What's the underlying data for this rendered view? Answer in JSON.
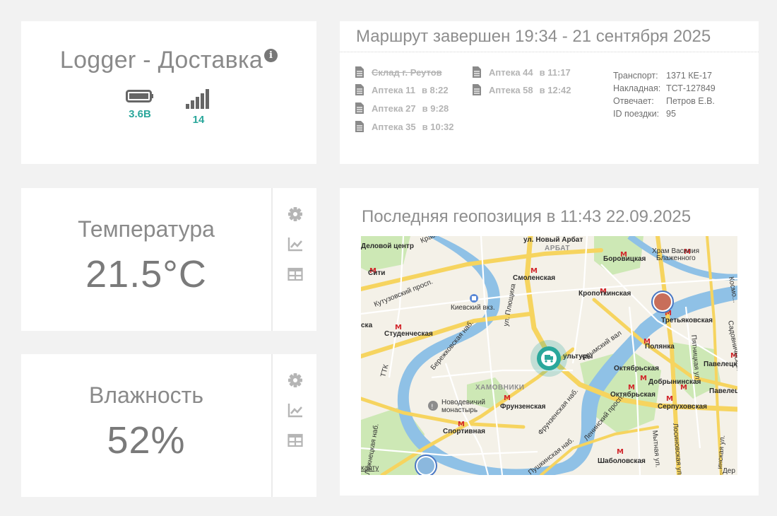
{
  "logger": {
    "title": "Logger - Доставка",
    "info_icon": "info-icon",
    "battery": {
      "icon": "battery-icon",
      "value": "3.6В"
    },
    "signal": {
      "icon": "signal-icon",
      "value": "14"
    }
  },
  "route": {
    "header": "Маршрут завершен 19:34 - 21 сентября 2025",
    "stops": [
      {
        "name": "Склад г. Реутов",
        "time": "",
        "done": true
      },
      {
        "name": "Аптека 11",
        "time": "в 8:22",
        "done": false
      },
      {
        "name": "Аптека 27",
        "time": "в 9:28",
        "done": false
      },
      {
        "name": "Аптека 35",
        "time": "в 10:32",
        "done": false
      },
      {
        "name": "Аптека 44",
        "time": "в 11:17",
        "done": false
      },
      {
        "name": "Аптека 58",
        "time": "в 12:42",
        "done": false
      }
    ],
    "info": [
      {
        "key": "Транспорт:",
        "value": "1371 КЕ-17"
      },
      {
        "key": "Накладная:",
        "value": "ТСТ-127849"
      },
      {
        "key": "Отвечает:",
        "value": "Петров Е.В."
      },
      {
        "key": "ID поездки:",
        "value": "95"
      }
    ]
  },
  "temperature": {
    "label": "Температура",
    "value": "21.5°C"
  },
  "humidity": {
    "label": "Влажность",
    "value": "52%"
  },
  "side_icons": [
    "gear-icon",
    "chart-icon",
    "table-icon"
  ],
  "map": {
    "header": "Последняя геопозиция в 11:43 22.09.2025",
    "labels": {
      "novy_arbat": "ул. Новый Арбат",
      "delovoy": "Деловой центр",
      "krasnopresn": "Краснопр...",
      "arbat": "АРБАТ",
      "borovitskaya": "Боровицкая",
      "hram": "Храм Василия",
      "blazhennogo": "Блаженного",
      "siti": "Сити",
      "smolenskaya": "Смоленская",
      "kutuzovsky": "Кутузовский просп.",
      "kropotkinskaya": "Кропоткинская",
      "kievsky": "Киевский вкз.",
      "kursovoi": "ул. Плющиха",
      "tretyakovskaya": "Третьяковская",
      "sadovnicheskaya": "Садовническая",
      "kosmo": "Космо...",
      "ska": "ска",
      "studencheskaya": "Студенческая",
      "berezhkovskaya": "Бережковская наб.",
      "kultury": "ультуры",
      "krymsky": "Крымский вал",
      "polyanka": "Полянка",
      "pyatnitskaya": "Пятницкая ул.",
      "paveletskaya1": "Павелецк...",
      "ttk": "ТТК",
      "oktyabrskaya1": "Октябрьская",
      "khamovniki": "ХАМОВНИКИ",
      "dobryninskaya": "Добрынинская",
      "paveletskaya2": "Павелец...",
      "oktyabrskaya2": "Октябрьская",
      "novodevichy1": "Новодевичий",
      "novodevichy2": "монастырь",
      "frunzenskaya": "Фрунзенская",
      "serpukhovskaya": "Серпуховская",
      "frunz_nab": "Фрунзенская наб.",
      "leninsky": "Ленинский просп.",
      "sportivnaya": "Спортивная",
      "mytnaya": "Мытная ул.",
      "losinoostrovskaya": "Лосиновская ул.",
      "luzhnetskaya": "Лужнецкая наб.",
      "pushkinskaya": "Пушкинская наб.",
      "shabolovskaya": "Шаболовская",
      "karty": "карту",
      "der": "Дер",
      "dinskaya": "...инская ул."
    },
    "marker_icon": "truck-icon"
  },
  "colors": {
    "accent": "#2aa79b",
    "river": "#7fb6e0",
    "park": "#c9e6b0",
    "road_major": "#f7d96b",
    "metro": "#d2262b"
  }
}
